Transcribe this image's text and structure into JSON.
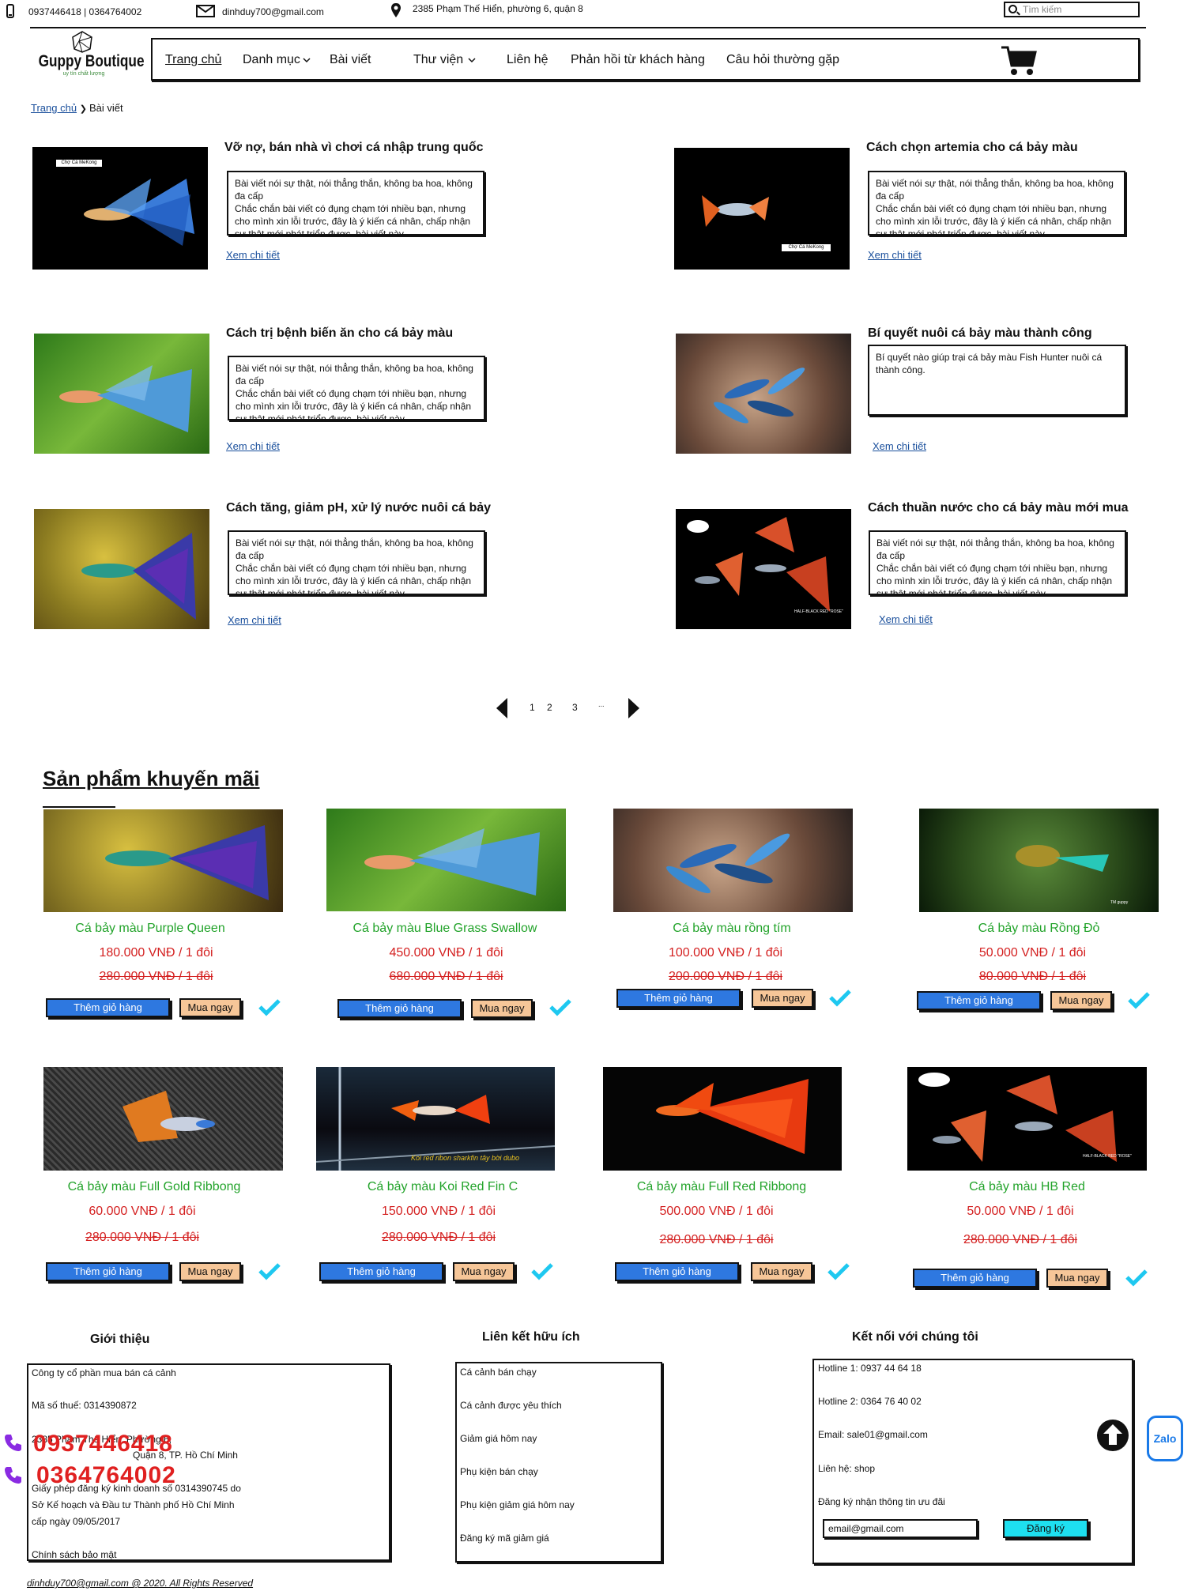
{
  "topbar": {
    "phone": "0937446418 | 0364764002",
    "email": "dinhduy700@gmail.com",
    "address": "2385 Phạm Thế Hiển, phường 6, quận 8",
    "search_placeholder": "Tìm kiếm"
  },
  "logo": {
    "name": "Guppy Boutique",
    "tagline": "uy tín chất lượng"
  },
  "nav": {
    "items": [
      "Trang chủ",
      "Danh mục",
      "Bài viết",
      "Thư viện",
      "Liên hệ",
      "Phản hồi từ khách hàng",
      "Câu hỏi thường gặp"
    ]
  },
  "breadcrumb": {
    "home": "Trang chủ",
    "current": "Bài viết"
  },
  "articles": [
    {
      "title": "Vỡ nợ, bán nhà vì chơi cá nhập trung quốc",
      "excerpt": "Bài viết nói sự thật, nói thẳng thắn, không ba hoa, không đa cấp\nChắc chắn bài viết có đụng chạm tới nhiều bạn, nhưng cho mình xin lỗi trước, đây là ý kiến cá nhân, chấp nhận sự thật mới phát triển được, bài viết này",
      "link": "Xem chi tiết",
      "img_label": "Chợ Cá MeKong"
    },
    {
      "title": "Cách chọn artemia cho cá bảy màu",
      "excerpt": "Bài viết nói sự thật, nói thẳng thắn, không ba hoa, không đa cấp\nChắc chắn bài viết có đụng chạm tới nhiều bạn, nhưng cho mình xin lỗi trước, đây là ý kiến cá nhân, chấp nhận sự thật mới phát triển được, bài viết này",
      "link": "Xem chi tiết",
      "img_label": "Chợ Cá MeKong"
    },
    {
      "title": "Cách trị bệnh biến ăn cho cá bảy màu",
      "excerpt": "Bài viết nói sự thật, nói thẳng thắn, không ba hoa, không đa cấp\nChắc chắn bài viết có đụng chạm tới nhiều bạn, nhưng cho mình xin lỗi trước, đây là ý kiến cá nhân, chấp nhận sự thật mới phát triển được, bài viết này",
      "link": "Xem chi tiết"
    },
    {
      "title": "Bí quyết nuôi cá bảy màu thành công",
      "excerpt": "Bí quyết nào giúp trại cá bảy màu Fish Hunter nuôi cá thành công.",
      "link": "Xem chi tiết"
    },
    {
      "title": "Cách tăng, giảm pH, xử lý nước nuôi cá bảy",
      "excerpt": "Bài viết nói sự thật, nói thẳng thắn, không ba hoa, không đa cấp\nChắc chắn bài viết có đụng chạm tới nhiều bạn, nhưng cho mình xin lỗi trước, đây là ý kiến cá nhân, chấp nhận sự thật mới phát triển được, bài viết này",
      "link": "Xem chi tiết"
    },
    {
      "title": "Cách thuần nước cho cá bảy màu mới mua",
      "excerpt": "Bài viết nói sự thật, nói thẳng thắn, không ba hoa, không đa cấp\nChắc chắn bài viết có đụng chạm tới nhiều bạn, nhưng cho mình xin lỗi trước, đây là ý kiến cá nhân, chấp nhận sự thật mới phát triển được, bài viết này",
      "link": "Xem chi tiết",
      "img_label": "HALF-BLACK RED \"ROSE\""
    }
  ],
  "pagination": {
    "pages": [
      "1",
      "2",
      "3",
      "..."
    ]
  },
  "promo": {
    "title": "Sản phẩm khuyến mãi",
    "cart_label": "Thêm giỏ hàng",
    "buy_label": "Mua ngay",
    "products": [
      {
        "name": "Cá bảy màu Purple Queen",
        "price": "180.000 VNĐ / 1 đôi",
        "old": "280.000 VNĐ / 1 đôi"
      },
      {
        "name": "Cá bảy màu Blue Grass Swallow",
        "price": "450.000 VNĐ / 1 đôi",
        "old": "680.000 VNĐ / 1 đôi"
      },
      {
        "name": "Cá bảy màu rồng tím",
        "price": "100.000 VNĐ / 1 đôi",
        "old": "200.000 VNĐ / 1 đôi"
      },
      {
        "name": "Cá bảy màu Rồng Đỏ",
        "price": "50.000 VNĐ / 1 đôi",
        "old": "80.000 VNĐ / 1 đôi",
        "img_label": "TM guppy"
      },
      {
        "name": "Cá bảy màu Full Gold Ribbong",
        "price": "60.000 VNĐ / 1 đôi",
        "old": "280.000 VNĐ / 1 đôi"
      },
      {
        "name": "Cá bảy màu Koi Red Fin C",
        "price": "150.000 VNĐ / 1 đôi",
        "old": "280.000 VNĐ / 1 đôi",
        "img_label": "Koi red ribon sharkfin tây bời dubo"
      },
      {
        "name": "Cá bảy màu Full Red Ribbong",
        "price": "500.000 VNĐ / 1 đôi",
        "old": "280.000 VNĐ / 1 đôi"
      },
      {
        "name": "Cá bảy màu HB Red",
        "price": "50.000 VNĐ / 1 đôi",
        "old": "280.000 VNĐ / 1 đôi",
        "img_label": "HALF-BLACK RED \"ROSE\""
      }
    ]
  },
  "footer": {
    "intro": {
      "title": "Giới thiệu",
      "lines": [
        "Công ty cổ phần mua bán cá cảnh",
        "Mã số thuế: 0314390872",
        "2385 Phạm Thế Hiển, Phường 6,",
        "Quận 8, TP. Hồ Chí Minh",
        "Giấy phép đăng ký kinh doanh số 0314390745 do",
        "Sở Kế hoạch và Đầu tư Thành phố Hồ Chí Minh",
        "cấp ngày 09/05/2017",
        "Chính sách bảo mật"
      ]
    },
    "links": {
      "title": "Liên kết hữu ích",
      "items": [
        "Cá cảnh bán chạy",
        "Cá cảnh được yêu thích",
        "Giảm giá hôm nay",
        "Phụ kiện bán chạy",
        "Phụ kiện giảm giá hôm nay",
        "Đăng ký mã giảm giá"
      ]
    },
    "connect": {
      "title": "Kết nối với chúng tôi",
      "lines": [
        "Hotline 1: 0937 44 64 18",
        "Hotline 2: 0364 76 40 02",
        "Email: sale01@gmail.com",
        "Liên hệ: shop",
        "Đăng ký nhận thông tin ưu đãi"
      ],
      "email_value": "email@gmail.com",
      "subscribe": "Đăng ký"
    },
    "phones": [
      "0937446418",
      "0364764002"
    ],
    "zalo": "Zalo",
    "copyright": "dinhduy700@gmail.com @ 2020. All Rights Reserved"
  }
}
